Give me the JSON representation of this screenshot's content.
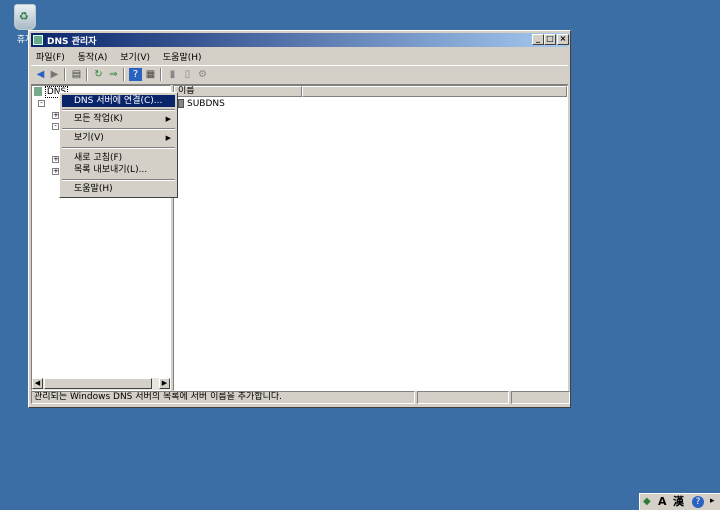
{
  "desktop": {
    "icon_label": "휴지"
  },
  "window": {
    "title": "DNS 관리자",
    "buttons": {
      "minimize": "_",
      "maximize": "□",
      "close": "×"
    }
  },
  "menubar": [
    {
      "label": "파일(F)"
    },
    {
      "label": "동작(A)"
    },
    {
      "label": "보기(V)"
    },
    {
      "label": "도움말(H)"
    }
  ],
  "toolbar": {
    "icons": [
      "back-icon",
      "forward-icon",
      "show-hide-tree-icon",
      "refresh-icon",
      "export-list-icon",
      "help-icon",
      "properties-icon",
      "server-icon",
      "zone-icon",
      "new-zone-icon"
    ]
  },
  "tree": {
    "root_label": "DNS"
  },
  "list": {
    "column_header": "이름",
    "rows": [
      {
        "name": "SUBDNS"
      }
    ]
  },
  "context_menu": {
    "items": [
      {
        "label": "DNS 서버에 연결(C)...",
        "highlighted": true
      },
      {
        "label": "모든 작업(K)",
        "submenu": true
      },
      {
        "label": "보기(V)",
        "submenu": true
      },
      {
        "label": "새로 고침(F)"
      },
      {
        "label": "목록 내보내기(L)..."
      },
      {
        "label": "도움말(H)"
      }
    ]
  },
  "statusbar": {
    "text": "관리되는 Windows DNS 서버의 목록에 서버 이름을 추가합니다."
  },
  "tray": {
    "ime_a": "A",
    "ime_hanja": "漢"
  },
  "colors": {
    "desktop": "#3a6ea5",
    "titlebar_start": "#0a246a",
    "titlebar_end": "#a6caf0",
    "face": "#d4d0c8",
    "highlight": "#0a246a"
  }
}
